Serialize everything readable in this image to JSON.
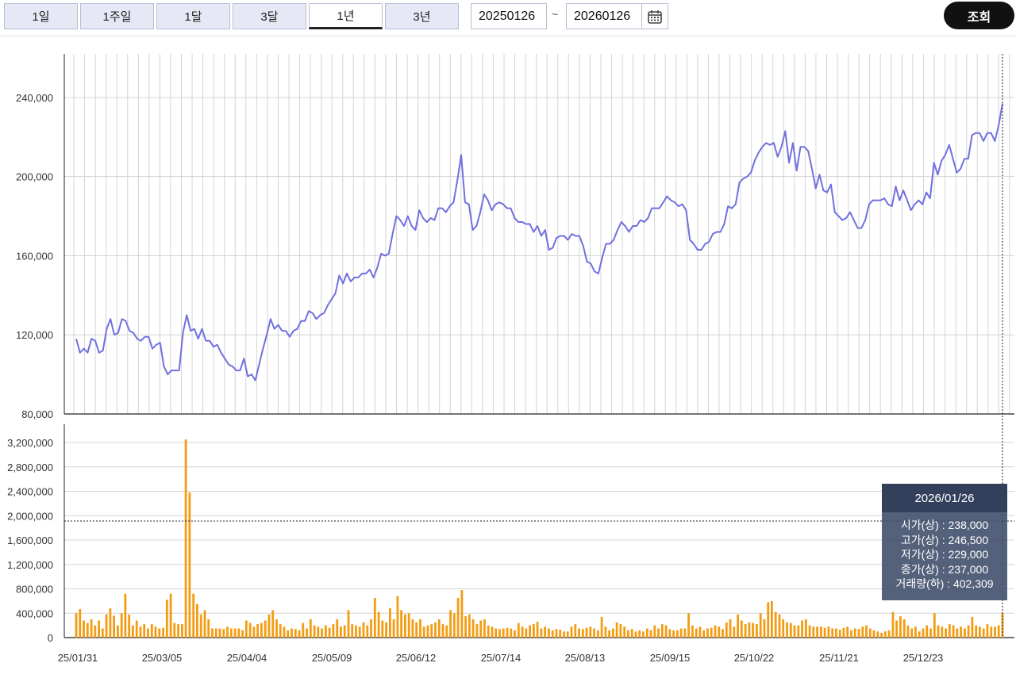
{
  "toolbar": {
    "periods": [
      "1일",
      "1주일",
      "1달",
      "3달",
      "1년",
      "3년"
    ],
    "active_period": "1년",
    "start_date": "20250126",
    "end_date": "20260126",
    "tilde": "~",
    "search_label": "조회",
    "calendar_icon": "calendar-icon"
  },
  "tooltip": {
    "date": "2026/01/26",
    "lines": [
      "시가(상) : 238,000",
      "고가(상) : 246,500",
      "저가(상) : 229,000",
      "종가(상) : 237,000",
      "거래량(하) : 402,309"
    ]
  },
  "colors": {
    "price_line": "#7070e0",
    "volume_bar": "#f39c12",
    "grid": "#d4d4d4"
  },
  "chart_data": [
    {
      "type": "line",
      "series": [
        {
          "name": "종가",
          "values": [
            118000,
            111000,
            113000,
            111000,
            118000,
            117000,
            111000,
            112000,
            123000,
            128000,
            120000,
            121000,
            128000,
            127000,
            122000,
            121000,
            118000,
            117000,
            119000,
            119000,
            113000,
            115000,
            116000,
            104000,
            100000,
            102000,
            102000,
            102000,
            121000,
            130000,
            122000,
            123000,
            118000,
            123000,
            117000,
            117000,
            114000,
            115000,
            111000,
            108000,
            105000,
            104000,
            102000,
            102000,
            108000,
            99000,
            100000,
            97000,
            105000,
            113000,
            120000,
            128000,
            123000,
            125000,
            122000,
            122000,
            119000,
            122000,
            123000,
            127000,
            127000,
            132000,
            131000,
            128000,
            130000,
            131000,
            135000,
            138000,
            141000,
            150000,
            146000,
            151000,
            147000,
            149000,
            149000,
            151000,
            151000,
            153000,
            149000,
            154000,
            161000,
            160000,
            161000,
            171000,
            180000,
            178000,
            175000,
            180000,
            175000,
            173000,
            183000,
            179000,
            177000,
            179000,
            178000,
            184000,
            184000,
            182000,
            185000,
            187000,
            198000,
            211000,
            187000,
            186000,
            173000,
            175000,
            182000,
            191000,
            188000,
            183000,
            186000,
            187000,
            186000,
            184000,
            184000,
            179000,
            177000,
            177000,
            176000,
            176000,
            172000,
            175000,
            170000,
            173000,
            163000,
            164000,
            169000,
            170000,
            170000,
            168000,
            171000,
            170000,
            170000,
            165000,
            157000,
            156000,
            152000,
            151000,
            159000,
            166000,
            166000,
            168000,
            173000,
            177000,
            175000,
            172000,
            175000,
            175000,
            178000,
            177000,
            179000,
            184000,
            184000,
            184000,
            187000,
            190000,
            188000,
            187000,
            185000,
            186000,
            183000,
            168000,
            166000,
            163000,
            163000,
            166000,
            167000,
            171000,
            172000,
            172000,
            176000,
            185000,
            184000,
            186000,
            197000,
            199000,
            200000,
            202000,
            208000,
            212000,
            215000,
            217000,
            216000,
            217000,
            210000,
            215000,
            223000,
            207000,
            217000,
            203000,
            215000,
            215000,
            213000,
            204000,
            194000,
            201000,
            193000,
            192000,
            196000,
            182000,
            180000,
            178000,
            179000,
            182000,
            178000,
            174000,
            174000,
            178000,
            186000,
            188000,
            188000,
            188000,
            189000,
            186000,
            185000,
            195000,
            188000,
            193000,
            188000,
            183000,
            186000,
            188000,
            186000,
            192000,
            189000,
            207000,
            201000,
            208000,
            211000,
            216000,
            209000,
            202000,
            204000,
            209000,
            209000,
            221000,
            222000,
            222000,
            218000,
            222000,
            222000,
            218000,
            226000,
            237000
          ]
        }
      ],
      "x_ticks": [
        "25/01/31",
        "25/03/05",
        "25/04/04",
        "25/05/09",
        "25/06/12",
        "25/07/14",
        "25/08/13",
        "25/09/15",
        "25/10/22",
        "25/11/21",
        "25/12/23"
      ],
      "y_ticks": [
        "80,000",
        "120,000",
        "160,000",
        "200,000",
        "240,000"
      ],
      "ylim": [
        80000,
        262000
      ],
      "grid": true
    },
    {
      "type": "bar",
      "series": [
        {
          "name": "거래량",
          "values": [
            402000,
            468000,
            280000,
            240000,
            300000,
            200000,
            280000,
            150000,
            380000,
            480000,
            360000,
            200000,
            400000,
            720000,
            380000,
            200000,
            280000,
            180000,
            220000,
            150000,
            220000,
            180000,
            150000,
            160000,
            620000,
            720000,
            240000,
            220000,
            220000,
            3250000,
            2380000,
            720000,
            550000,
            380000,
            450000,
            300000,
            150000,
            150000,
            150000,
            140000,
            180000,
            150000,
            150000,
            150000,
            120000,
            280000,
            240000,
            180000,
            220000,
            240000,
            280000,
            380000,
            450000,
            300000,
            220000,
            180000,
            120000,
            150000,
            140000,
            120000,
            240000,
            150000,
            300000,
            200000,
            180000,
            150000,
            200000,
            160000,
            220000,
            300000,
            180000,
            200000,
            450000,
            220000,
            200000,
            180000,
            250000,
            200000,
            300000,
            650000,
            420000,
            280000,
            250000,
            480000,
            300000,
            680000,
            450000,
            380000,
            400000,
            300000,
            250000,
            300000,
            180000,
            200000,
            220000,
            250000,
            300000,
            220000,
            200000,
            450000,
            400000,
            650000,
            780000,
            350000,
            380000,
            300000,
            220000,
            280000,
            300000,
            200000,
            180000,
            150000,
            140000,
            150000,
            160000,
            150000,
            120000,
            240000,
            180000,
            150000,
            200000,
            220000,
            260000,
            150000,
            180000,
            150000,
            120000,
            140000,
            130000,
            100000,
            100000,
            180000,
            220000,
            150000,
            140000,
            160000,
            180000,
            150000,
            120000,
            340000,
            180000,
            120000,
            150000,
            250000,
            220000,
            180000,
            120000,
            140000,
            100000,
            120000,
            100000,
            150000,
            120000,
            200000,
            150000,
            220000,
            200000,
            140000,
            120000,
            120000,
            150000,
            150000,
            400000,
            200000,
            150000,
            180000,
            120000,
            150000,
            160000,
            200000,
            180000,
            140000,
            250000,
            300000,
            180000,
            380000,
            280000,
            220000,
            250000,
            240000,
            220000,
            400000,
            300000,
            580000,
            600000,
            420000,
            380000,
            300000,
            250000,
            240000,
            200000,
            200000,
            280000,
            300000,
            200000,
            180000,
            180000,
            180000,
            160000,
            180000,
            150000,
            150000,
            130000,
            160000,
            180000,
            120000,
            150000,
            140000,
            180000,
            200000,
            150000,
            120000,
            100000,
            80000,
            100000,
            120000,
            420000,
            280000,
            350000,
            300000,
            200000,
            150000,
            180000,
            100000,
            150000,
            200000,
            150000,
            400000,
            200000,
            180000,
            150000,
            220000,
            200000,
            150000,
            180000,
            150000,
            200000,
            340000,
            200000,
            180000,
            150000,
            220000,
            180000,
            180000,
            200000,
            402309
          ]
        }
      ],
      "y_ticks": [
        "0",
        "400,000",
        "800,000",
        "1,200,000",
        "1,600,000",
        "2,000,000",
        "2,400,000",
        "2,800,000",
        "3,200,000"
      ],
      "ylim": [
        0,
        3500000
      ],
      "grid": true
    }
  ]
}
